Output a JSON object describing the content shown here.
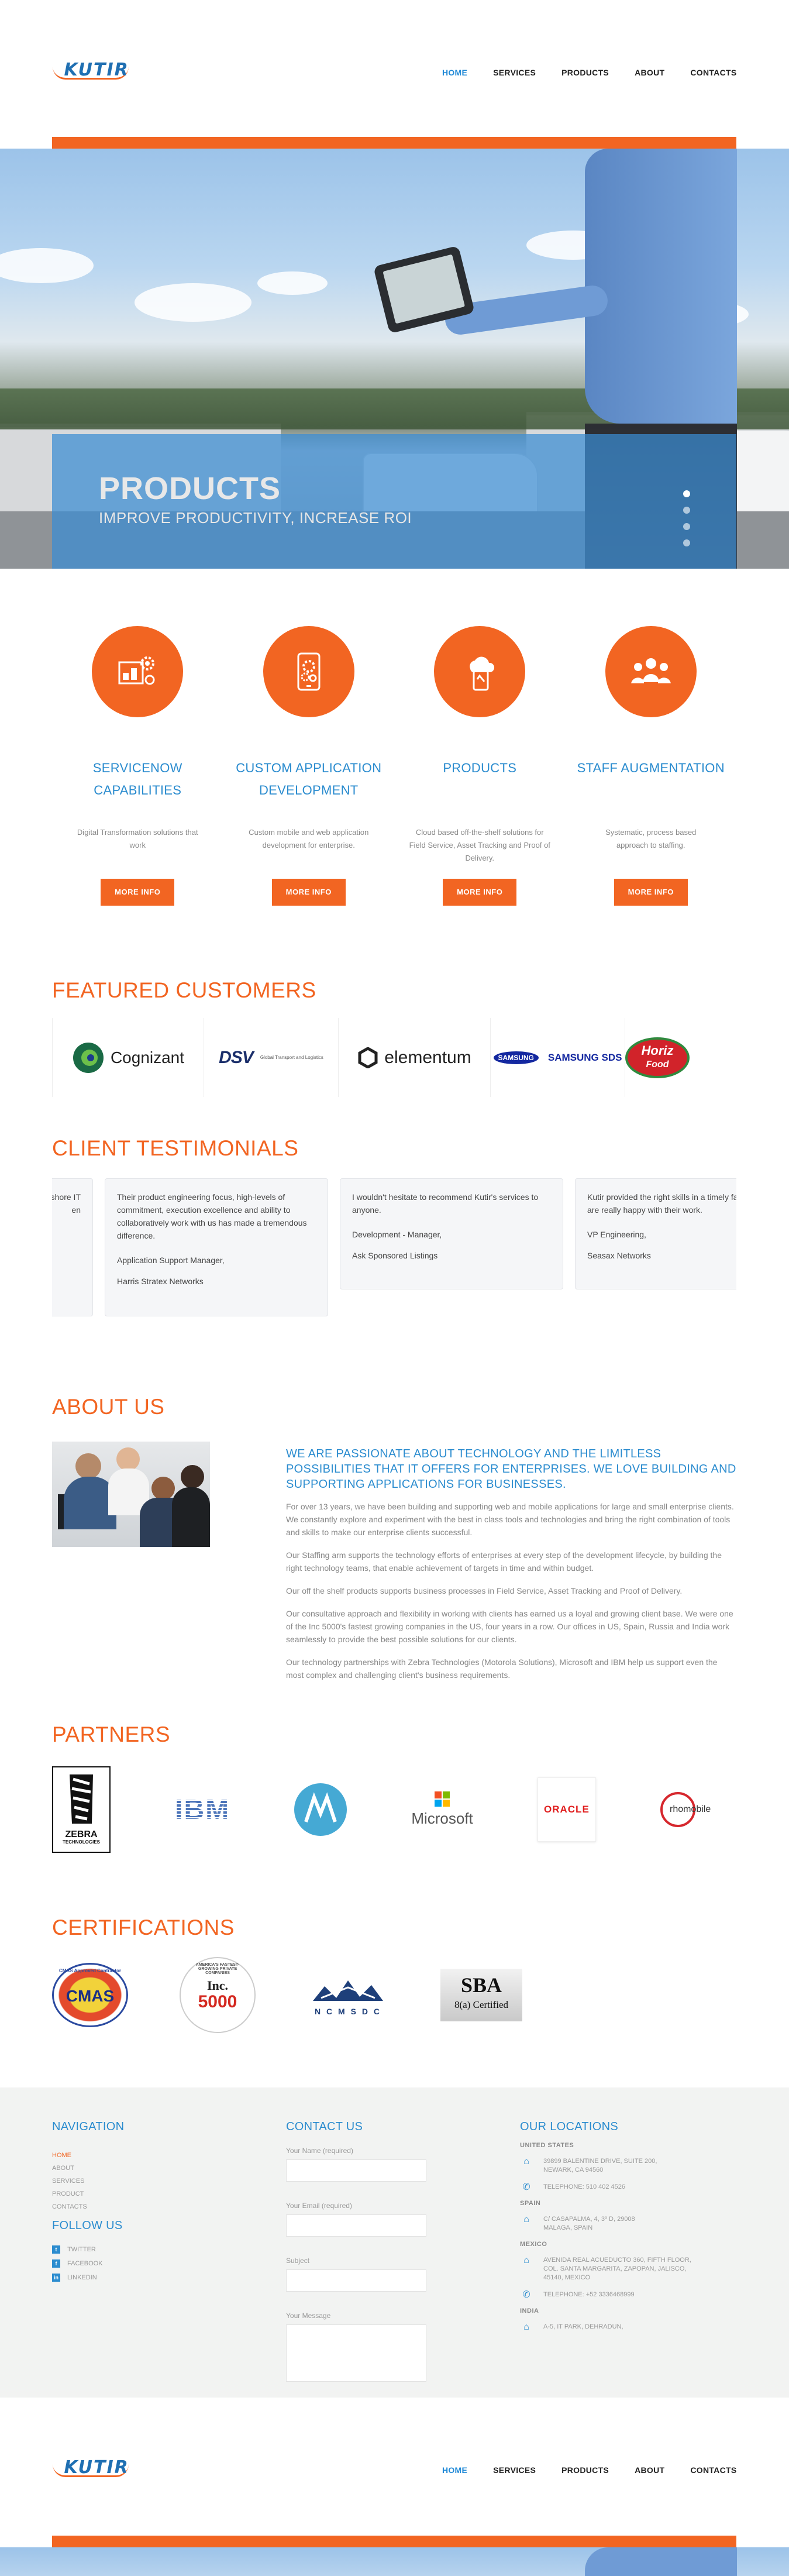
{
  "brand": {
    "logo_text": "KUTIR",
    "accent": "#f26522",
    "blue": "#2b8ccf"
  },
  "nav": {
    "items": [
      "HOME",
      "SERVICES",
      "PRODUCTS",
      "ABOUT",
      "CONTACTS"
    ],
    "active": "HOME"
  },
  "hero": {
    "title": "PRODUCTS",
    "subtitle": "IMPROVE PRODUCTIVITY, INCREASE ROI",
    "slides_count": 4,
    "active_slide": 1
  },
  "services": [
    {
      "title_line1": "SERVICENOW",
      "title_line2": "CAPABILITIES",
      "desc": "Digital Transformation solutions that work",
      "button": "MORE INFO",
      "icon": "workflow-gear-icon"
    },
    {
      "title_line1": "CUSTOM APPLICATION",
      "title_line2": "DEVELOPMENT",
      "desc": "Custom mobile and web application development for enterprise.",
      "button": "MORE INFO",
      "icon": "mobile-gears-icon"
    },
    {
      "title_line1": "PRODUCTS",
      "title_line2": "",
      "desc": "Cloud based off-the-shelf solutions for Field Service, Asset Tracking and Proof of Delivery.",
      "button": "MORE INFO",
      "icon": "cloud-product-icon"
    },
    {
      "title_line1": "STAFF AUGMENTATION",
      "title_line2": "",
      "desc": "Systematic, process based approach to staffing.",
      "button": "MORE INFO",
      "icon": "team-icon"
    }
  ],
  "customers": {
    "title": "FEATURED CUSTOMERS",
    "logos": [
      "Cognizant",
      "DSV",
      "Global Transport and Logistics",
      "elementum",
      "SAMSUNG",
      "SAMSUNG SDS",
      "Horiz",
      "Food"
    ]
  },
  "testimonials": {
    "title": "CLIENT TESTIMONIALS",
    "items": [
      {
        "quote": "shore IT",
        "quote2": "en",
        "role": "",
        "company": ""
      },
      {
        "quote": "Their product engineering focus, high-levels of commitment, execution excellence and ability to collaboratively work with us has made a tremendous difference.",
        "role": "Application Support Manager,",
        "company": "Harris Stratex Networks"
      },
      {
        "quote": "I wouldn't hesitate to recommend Kutir's services to anyone.",
        "role": "Development - Manager,",
        "company": "Ask Sponsored Listings"
      },
      {
        "quote": "Kutir provided the right skills in a timely fa",
        "quote2": "are really happy with their work.",
        "role": "VP Engineering,",
        "company": "Seasax Networks"
      }
    ]
  },
  "about": {
    "title": "ABOUT US",
    "heading": "WE ARE PASSIONATE ABOUT TECHNOLOGY AND THE LIMITLESS POSSIBILITIES THAT IT OFFERS FOR ENTERPRISES. WE LOVE BUILDING AND SUPPORTING APPLICATIONS FOR BUSINESSES.",
    "paragraphs": [
      "For over 13 years, we have been building and supporting web and mobile applications for large and small enterprise clients. We constantly explore and experiment with the best in class tools and technologies and bring the right combination of tools and skills to make our enterprise clients successful.",
      "Our Staffing arm supports the technology efforts of enterprises at every step of the development lifecycle, by building the right technology teams, that enable achievement of targets in time and within budget.",
      "Our off the shelf products supports business processes in Field Service, Asset Tracking and Proof of Delivery.",
      "Our consultative approach and flexibility in working with clients has earned us a loyal and growing client base. We were one of the Inc 5000's fastest growing companies in the US, four years in a row. Our offices in US, Spain, Russia and India work seamlessly to provide the best possible solutions for our clients.",
      "Our technology partnerships with Zebra Technologies (Motorola Solutions), Microsoft and IBM help us support even the most complex and challenging client's business requirements."
    ]
  },
  "partners": {
    "title": "PARTNERS",
    "logos": [
      "ZEBRA",
      "TECHNOLOGIES",
      "IBM",
      "Microsoft",
      "ORACLE",
      "rhomobile"
    ]
  },
  "certifications": {
    "title": "CERTIFICATIONS",
    "logos": [
      "CMAS Approved Contractor",
      "CMAS",
      "AMERICA'S FASTEST-GROWING PRIVATE COMPANIES",
      "Inc.",
      "5000",
      "N C M S D C",
      "SBA",
      "8(a) Certified"
    ]
  },
  "footer": {
    "navigation": {
      "title": "NAVIGATION",
      "links": [
        "HOME",
        "ABOUT",
        "SERVICES",
        "PRODUCT",
        "CONTACTS"
      ],
      "active": "HOME"
    },
    "follow": {
      "title": "FOLLOW US",
      "links": [
        "TWITTER",
        "FACEBOOK",
        "LINKEDIN"
      ]
    },
    "contact": {
      "title": "CONTACT US",
      "fields": [
        "Your Name (required)",
        "Your Email (required)",
        "Subject",
        "Your Message"
      ]
    },
    "locations": {
      "title": "OUR LOCATIONS",
      "groups": [
        {
          "country": "UNITED STATES",
          "lines": [
            {
              "icon": "home-icon",
              "text": "39899 BALENTINE DRIVE, SUITE 200, NEWARK, CA 94560"
            },
            {
              "icon": "phone-icon",
              "text": "TELEPHONE: 510 402 4526"
            }
          ]
        },
        {
          "country": "SPAIN",
          "lines": [
            {
              "icon": "home-icon",
              "text": "C/ CASAPALMA, 4, 3º D, 29008 MALAGA, SPAIN"
            }
          ]
        },
        {
          "country": "MEXICO",
          "lines": [
            {
              "icon": "home-icon",
              "text": "AVENIDA REAL ACUEDUCTO 360, FIFTH FLOOR, COL. SANTA MARGARITA, ZAPOPAN, JALISCO, 45140, MEXICO"
            },
            {
              "icon": "phone-icon",
              "text": "TELEPHONE: +52 3336468999"
            }
          ]
        },
        {
          "country": "INDIA",
          "lines": [
            {
              "icon": "home-icon",
              "text": "A-5, IT PARK, DEHRADUN,"
            }
          ]
        }
      ]
    }
  }
}
